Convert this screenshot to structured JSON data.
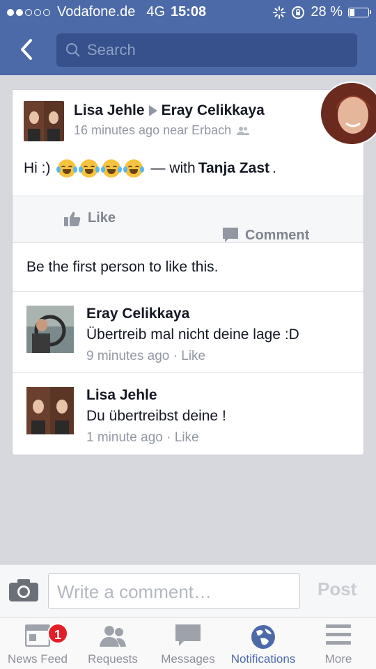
{
  "status_bar": {
    "carrier": "Vodafone.de",
    "network": "4G",
    "time": "15:08",
    "battery": "28 %",
    "battery_level": 0.28
  },
  "search": {
    "placeholder": "Search"
  },
  "post": {
    "author": "Lisa Jehle",
    "target": "Eray Celikkaya",
    "time_location": "16 minutes ago near Erbach",
    "text": "Hi :)",
    "with_prefix": "— with",
    "with_name": "Tanja Zast",
    "with_suffix": ".",
    "like_label": "Like",
    "comment_label": "Comment",
    "likes_line": "Be the first person to like this."
  },
  "comments": [
    {
      "name": "Eray Celikkaya",
      "text": "Übertreib mal nicht deine lage :D",
      "time": "9 minutes ago",
      "action": "Like"
    },
    {
      "name": "Lisa Jehle",
      "text": "Du übertreibst deine !",
      "time": "1 minute ago",
      "action": "Like"
    }
  ],
  "composer": {
    "placeholder": "Write a comment…",
    "post_label": "Post"
  },
  "tabs": [
    {
      "label": "News Feed",
      "icon": "news-feed-icon",
      "badge": "1"
    },
    {
      "label": "Requests",
      "icon": "requests-icon"
    },
    {
      "label": "Messages",
      "icon": "messages-icon"
    },
    {
      "label": "Notifications",
      "icon": "globe-icon",
      "active": true
    },
    {
      "label": "More",
      "icon": "menu-icon"
    }
  ],
  "colors": {
    "brand": "#4c6aa8",
    "search_bg": "#36518c",
    "badge": "#e41e26"
  }
}
